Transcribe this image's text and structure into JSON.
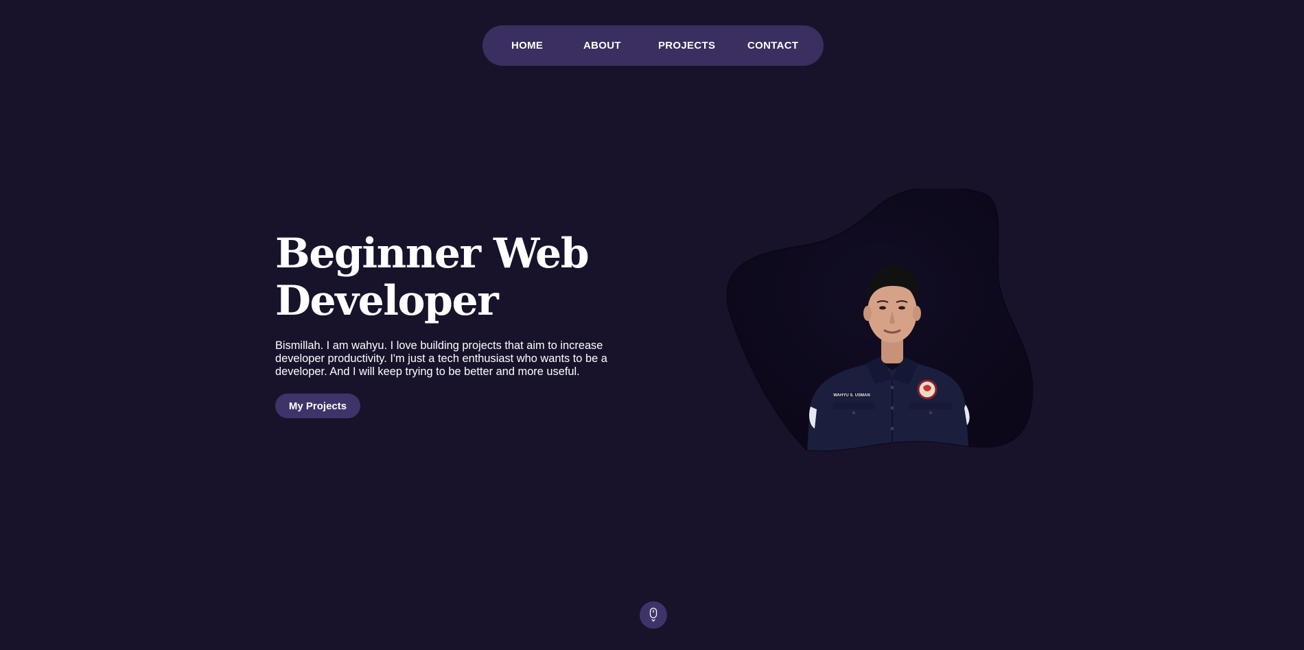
{
  "nav": {
    "items": [
      {
        "label": "HOME"
      },
      {
        "label": "ABOUT"
      },
      {
        "label": "PROJECTS"
      },
      {
        "label": "CONTACT"
      }
    ]
  },
  "hero": {
    "title_line1": "Beginner Web",
    "title_line2": "Developer",
    "description_lines": [
      "Bismillah. I am wahyu. I love building projects that aim to increase",
      "developer productivity. I'm just a tech enthusiast who wants to be a",
      "developer. And I will keep trying to be better and more useful."
    ],
    "button_label": "My Projects"
  },
  "portrait": {
    "name_tag": "WAHYU S. USMAN"
  },
  "scroll": {
    "icon": "mouse-scroll-icon"
  },
  "colors": {
    "background": "#18132b",
    "nav_bg": "#3a2f5f",
    "button_bg": "#3f3469",
    "blob": "#0f0b1e",
    "text": "#ffffff"
  }
}
